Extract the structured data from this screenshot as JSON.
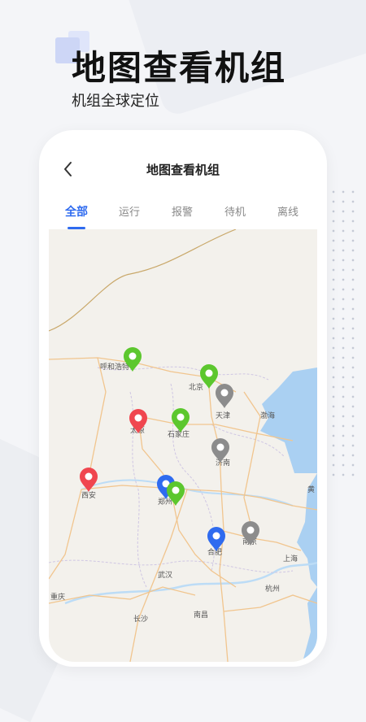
{
  "header": {
    "title": "地图查看机组",
    "subtitle": "机组全球定位"
  },
  "screen": {
    "title": "地图查看机组"
  },
  "tabs": [
    {
      "label": "全部"
    },
    {
      "label": "运行"
    },
    {
      "label": "报警"
    },
    {
      "label": "待机"
    },
    {
      "label": "离线"
    }
  ],
  "map": {
    "cities": {
      "hohhot": "呼和浩特",
      "beijing": "北京",
      "tianjin": "天津",
      "bohai": "渤海",
      "taiyuan": "太原",
      "shijiazhuang": "石家庄",
      "jinan": "济南",
      "xian": "西安",
      "zhengzhou": "郑州",
      "hefei": "合肥",
      "nanjing": "南京",
      "shanghai": "上海",
      "wuhan": "武汉",
      "chongqing": "重庆",
      "hangzhou": "杭州",
      "changsha": "长沙",
      "nanchang": "南昌",
      "huang": "黄"
    },
    "status_colors": {
      "running": "#5cc72e",
      "alarm": "#f0464f",
      "standby": "#8c8c8c",
      "online": "#2f6bef"
    },
    "markers": [
      {
        "city": "呼和浩特",
        "status": "running"
      },
      {
        "city": "北京",
        "status": "running"
      },
      {
        "city": "天津",
        "status": "standby"
      },
      {
        "city": "太原",
        "status": "alarm"
      },
      {
        "city": "石家庄",
        "status": "running"
      },
      {
        "city": "济南",
        "status": "standby"
      },
      {
        "city": "西安",
        "status": "alarm"
      },
      {
        "city": "郑州",
        "status": "online"
      },
      {
        "city": "郑州",
        "status": "running"
      },
      {
        "city": "合肥",
        "status": "online"
      },
      {
        "city": "南京",
        "status": "standby"
      }
    ]
  }
}
